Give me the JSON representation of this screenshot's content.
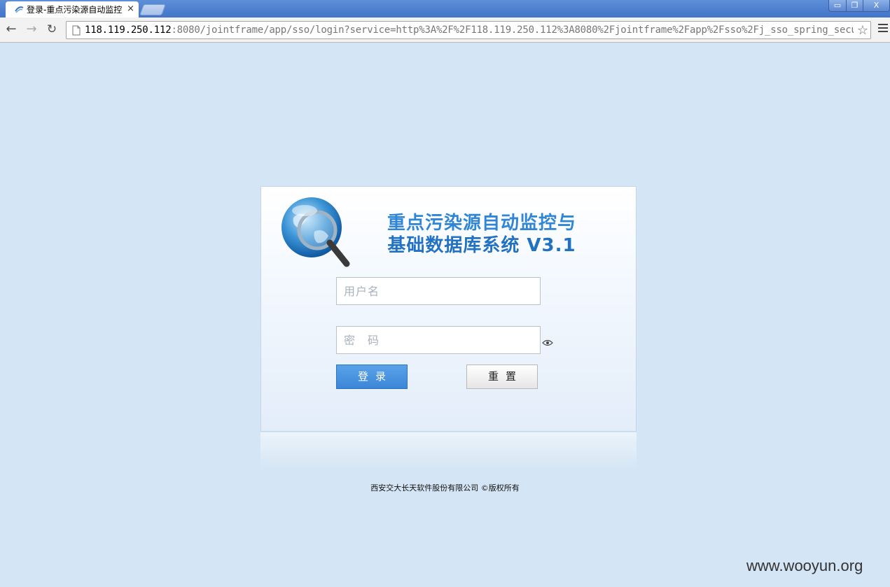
{
  "browser": {
    "tab_title": "登录-重点污染源自动监控",
    "tab_close": "×",
    "window_controls": {
      "minimize": "▭",
      "maximize": "❐",
      "close": "X"
    },
    "nav": {
      "back": "←",
      "forward": "→",
      "reload": "↻"
    },
    "url_host": "118.119.250.112",
    "url_rest": ":8080/jointframe/app/sso/login?service=http%3A%2F%2F118.119.250.112%3A8080%2Fjointframe%2Fapp%2Fsso%2Fj_sso_spring_security",
    "star": "☆"
  },
  "login": {
    "title_line1": "重点污染源自动监控与",
    "title_line2": "基础数据库系统 V3.1",
    "username_placeholder": "用户名",
    "password_placeholder": "密　码",
    "login_button": "登录",
    "reset_button": "重置"
  },
  "footer": {
    "copyright": "西安交大长天软件股份有限公司 ©版权所有"
  },
  "watermark": "www.wooyun.org",
  "colors": {
    "page_background": "#d4e5f5",
    "title_blue": "#2a7fcf",
    "login_button": "#3b86d8"
  }
}
